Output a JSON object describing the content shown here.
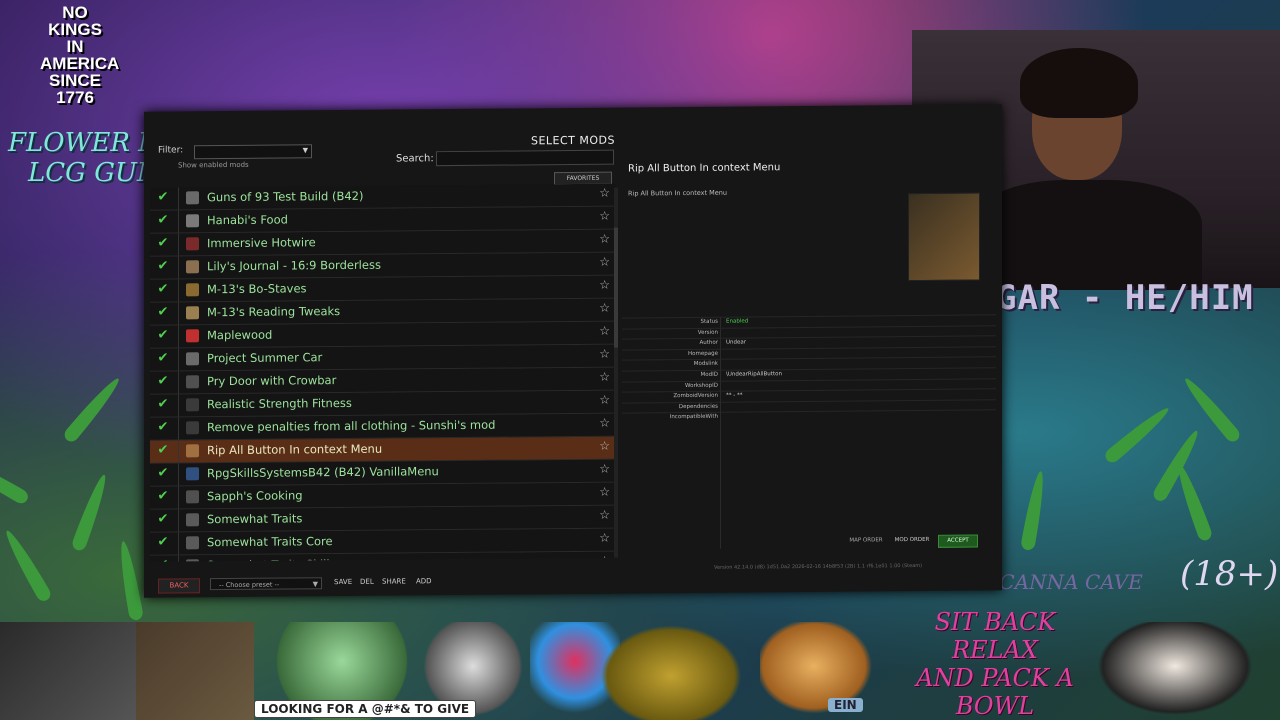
{
  "overlay": {
    "nokings_lines": [
      "NO",
      "KINGS",
      "IN",
      "AMERICA",
      "SINCE",
      "1776"
    ],
    "flower_menu": "FLOWER MENU",
    "lcg_gumbo": "LCG GUMBO",
    "pronouns": "GAR - HE/HIM",
    "age_badge": "(18+)",
    "welcome": "WELCOME TO THE CANNA CAVE",
    "sit_back_lines": [
      "SIT BACK",
      "RELAX",
      "AND PACK A BOWL"
    ],
    "looking": "LOOKING FOR A @#*& TO GIVE",
    "ein": "EIN"
  },
  "game": {
    "title": "SELECT MODS",
    "filter_label": "Filter:",
    "show_enabled": "Show enabled mods",
    "search_label": "Search:",
    "search_value": "",
    "favorites_label": "FAVORITES",
    "mods": [
      {
        "name": "Guns of 93 Test Build (B42)",
        "enabled": true,
        "selected": false,
        "icon_color": "#6a6a6a"
      },
      {
        "name": "Hanabi's Food",
        "enabled": true,
        "selected": false,
        "icon_color": "#7a7a7a"
      },
      {
        "name": "Immersive Hotwire",
        "enabled": true,
        "selected": false,
        "icon_color": "#7a2a2a"
      },
      {
        "name": "Lily's Journal - 16:9 Borderless",
        "enabled": true,
        "selected": false,
        "icon_color": "#8a7050"
      },
      {
        "name": "M-13's Bo-Staves",
        "enabled": true,
        "selected": false,
        "icon_color": "#8a6a30"
      },
      {
        "name": "M-13's Reading Tweaks",
        "enabled": true,
        "selected": false,
        "icon_color": "#9a8050"
      },
      {
        "name": "Maplewood",
        "enabled": true,
        "selected": false,
        "icon_color": "#c03030"
      },
      {
        "name": "Project Summer Car",
        "enabled": true,
        "selected": false,
        "icon_color": "#6a6a6a"
      },
      {
        "name": "Pry Door with Crowbar",
        "enabled": true,
        "selected": false,
        "icon_color": "#505050"
      },
      {
        "name": "Realistic Strength Fitness",
        "enabled": true,
        "selected": false,
        "icon_color": "#3a3a3a"
      },
      {
        "name": "Remove penalties from all clothing - Sunshi's mod",
        "enabled": true,
        "selected": false,
        "icon_color": "#3a3a3a"
      },
      {
        "name": "Rip All Button In context Menu",
        "enabled": true,
        "selected": true,
        "icon_color": "#a07040"
      },
      {
        "name": "RpgSkillsSystemsB42 (B42) VanillaMenu",
        "enabled": true,
        "selected": false,
        "icon_color": "#305080"
      },
      {
        "name": "Sapph's Cooking",
        "enabled": true,
        "selected": false,
        "icon_color": "#505050"
      },
      {
        "name": "Somewhat Traits",
        "enabled": true,
        "selected": false,
        "icon_color": "#5a5a5a"
      },
      {
        "name": "Somewhat Traits Core",
        "enabled": true,
        "selected": false,
        "icon_color": "#5a5a5a"
      },
      {
        "name": "Somewhat Traits Skills",
        "enabled": true,
        "selected": false,
        "icon_color": "#5a5a5a"
      }
    ],
    "check_glyph": "✔",
    "star_glyph": "☆",
    "bottom": {
      "back": "BACK",
      "preset": "-- Choose preset --",
      "save": "SAVE",
      "del": "DEL",
      "share": "SHARE",
      "add": "ADD"
    },
    "detail": {
      "title": "Rip All Button In context Menu",
      "description": "Rip All Button In context Menu",
      "meta": [
        {
          "key": "Status",
          "value": "Enabled",
          "green": true
        },
        {
          "key": "Version",
          "value": ""
        },
        {
          "key": "Author",
          "value": "Undear"
        },
        {
          "key": "Homepage",
          "value": ""
        },
        {
          "key": "Modslink",
          "value": ""
        },
        {
          "key": "ModID",
          "value": "\\UndearRipAllButton"
        },
        {
          "key": "WorkshopID",
          "value": ""
        },
        {
          "key": "ZomboidVersion",
          "value": "** - **"
        },
        {
          "key": "Dependencies",
          "value": ""
        },
        {
          "key": "IncompatibleWith",
          "value": ""
        }
      ],
      "map_order": "MAP ORDER",
      "mod_order": "MOD ORDER",
      "accept": "ACCEPT",
      "version_line": "Version 42.14.0 (d8) 1d51.0a2 2026-02-16 14b8f53 (2B) 1.1 rf6.1e01 1.00 (Steam)"
    }
  }
}
